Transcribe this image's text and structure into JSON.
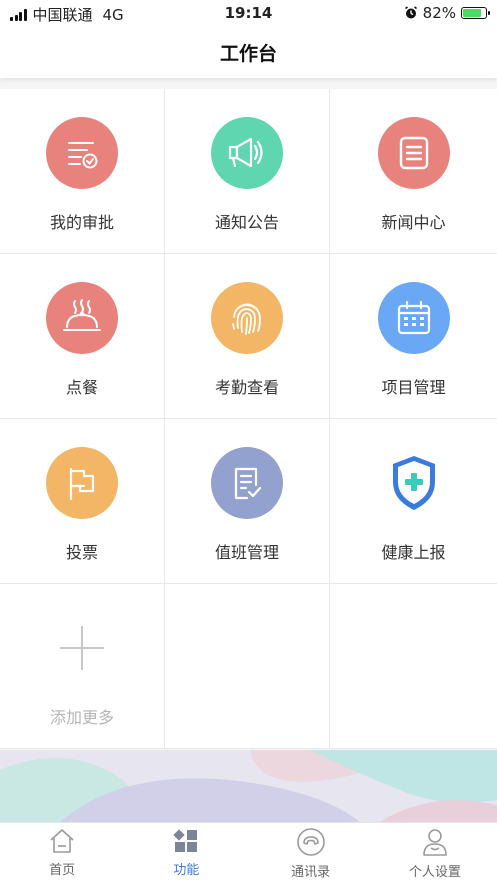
{
  "status_bar": {
    "carrier": "中国联通",
    "network": "4G",
    "time": "19:14",
    "battery": "82%",
    "battery_level": 0.82
  },
  "header": {
    "title": "工作台"
  },
  "features": [
    {
      "label": "我的审批",
      "icon": "approval-icon",
      "color": "#e8827c"
    },
    {
      "label": "通知公告",
      "icon": "megaphone-icon",
      "color": "#5fd6b0"
    },
    {
      "label": "新闻中心",
      "icon": "news-icon",
      "color": "#e8827c"
    },
    {
      "label": "点餐",
      "icon": "food-cloche-icon",
      "color": "#e8827c"
    },
    {
      "label": "考勤查看",
      "icon": "fingerprint-icon",
      "color": "#f3b666"
    },
    {
      "label": "项目管理",
      "icon": "calendar-icon",
      "color": "#6aa7f5"
    },
    {
      "label": "投票",
      "icon": "flag-icon",
      "color": "#f3b666"
    },
    {
      "label": "值班管理",
      "icon": "duty-checklist-icon",
      "color": "#93a1cf"
    },
    {
      "label": "健康上报",
      "icon": "health-shield-icon",
      "color": "#3a7be0"
    }
  ],
  "add_more": {
    "label": "添加更多",
    "icon": "plus-icon"
  },
  "tab_bar": {
    "tabs": [
      {
        "label": "首页",
        "icon": "home-icon",
        "active": false
      },
      {
        "label": "功能",
        "icon": "grid-icon",
        "active": true
      },
      {
        "label": "通讯录",
        "icon": "phone-icon",
        "active": false
      },
      {
        "label": "个人设置",
        "icon": "user-icon",
        "active": false
      }
    ]
  }
}
